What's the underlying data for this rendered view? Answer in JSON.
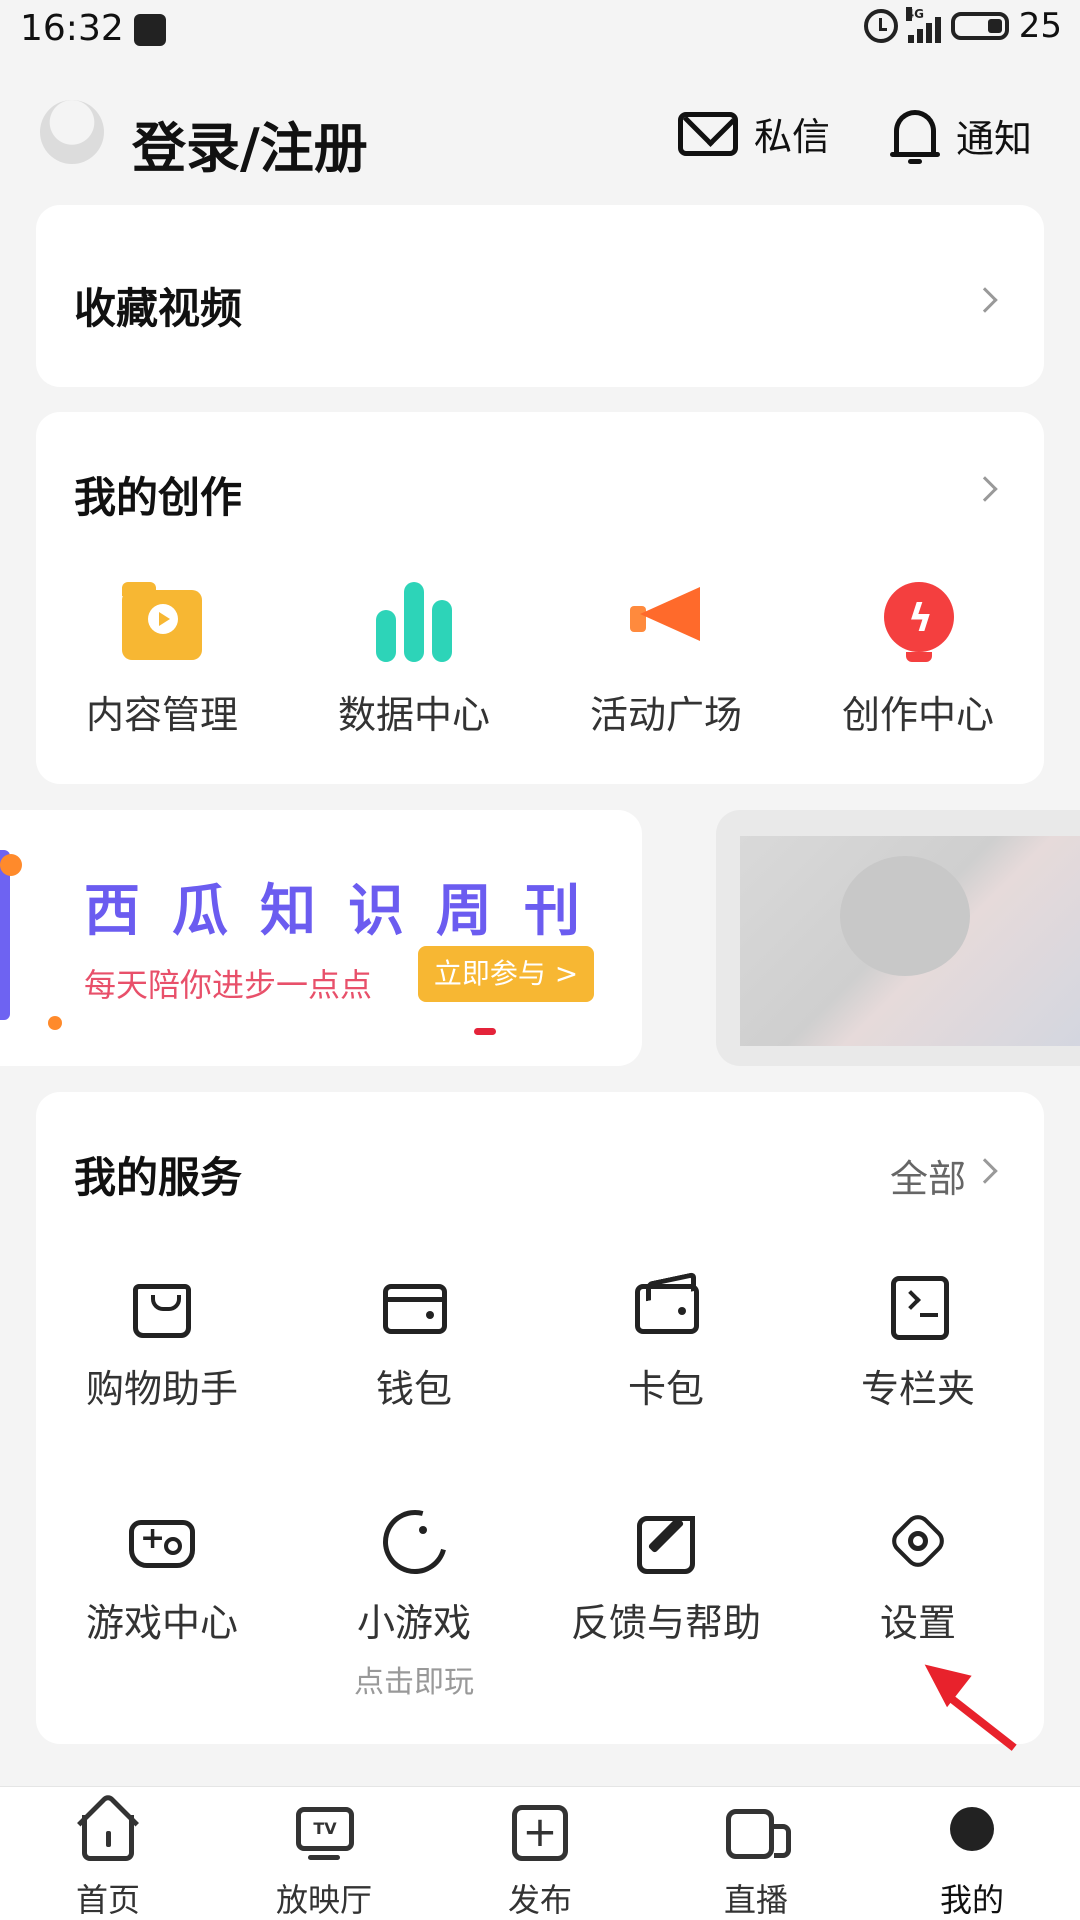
{
  "status_bar": {
    "time": "16:32",
    "network": "4G",
    "battery": "25"
  },
  "header": {
    "login_label": "登录/注册",
    "messages_label": "私信",
    "notify_label": "通知"
  },
  "favorites": {
    "title": "收藏视频"
  },
  "creation": {
    "title": "我的创作",
    "items": [
      {
        "label": "内容管理",
        "icon": "folder-play-icon",
        "color": "#f7b733"
      },
      {
        "label": "数据中心",
        "icon": "bar-chart-icon",
        "color": "#2dd4b8"
      },
      {
        "label": "活动广场",
        "icon": "megaphone-icon",
        "color": "#ff6a2b"
      },
      {
        "label": "创作中心",
        "icon": "lightning-bulb-icon",
        "color": "#f43f3f"
      }
    ]
  },
  "banner": {
    "title": "西瓜知识周刊",
    "subtitle": "每天陪你进步一点点",
    "cta": "立即参与 >",
    "title_color": "#6b5cf0",
    "cta_color": "#f7b733"
  },
  "services": {
    "title": "我的服务",
    "all_label": "全部",
    "items": [
      {
        "label": "购物助手",
        "icon": "shopping-bag-icon"
      },
      {
        "label": "钱包",
        "icon": "wallet-icon"
      },
      {
        "label": "卡包",
        "icon": "card-holder-icon"
      },
      {
        "label": "专栏夹",
        "icon": "column-folder-icon"
      },
      {
        "label": "游戏中心",
        "icon": "gamepad-icon"
      },
      {
        "label": "小游戏",
        "sub": "点击即玩",
        "icon": "pacman-icon"
      },
      {
        "label": "反馈与帮助",
        "icon": "edit-icon"
      },
      {
        "label": "设置",
        "icon": "settings-icon"
      }
    ]
  },
  "tabbar": {
    "items": [
      {
        "label": "首页",
        "icon": "home-icon"
      },
      {
        "label": "放映厅",
        "icon": "tv-icon",
        "badge": "TV"
      },
      {
        "label": "发布",
        "icon": "plus-icon"
      },
      {
        "label": "直播",
        "icon": "camera-icon"
      },
      {
        "label": "我的",
        "icon": "profile-icon",
        "active": true
      }
    ]
  }
}
